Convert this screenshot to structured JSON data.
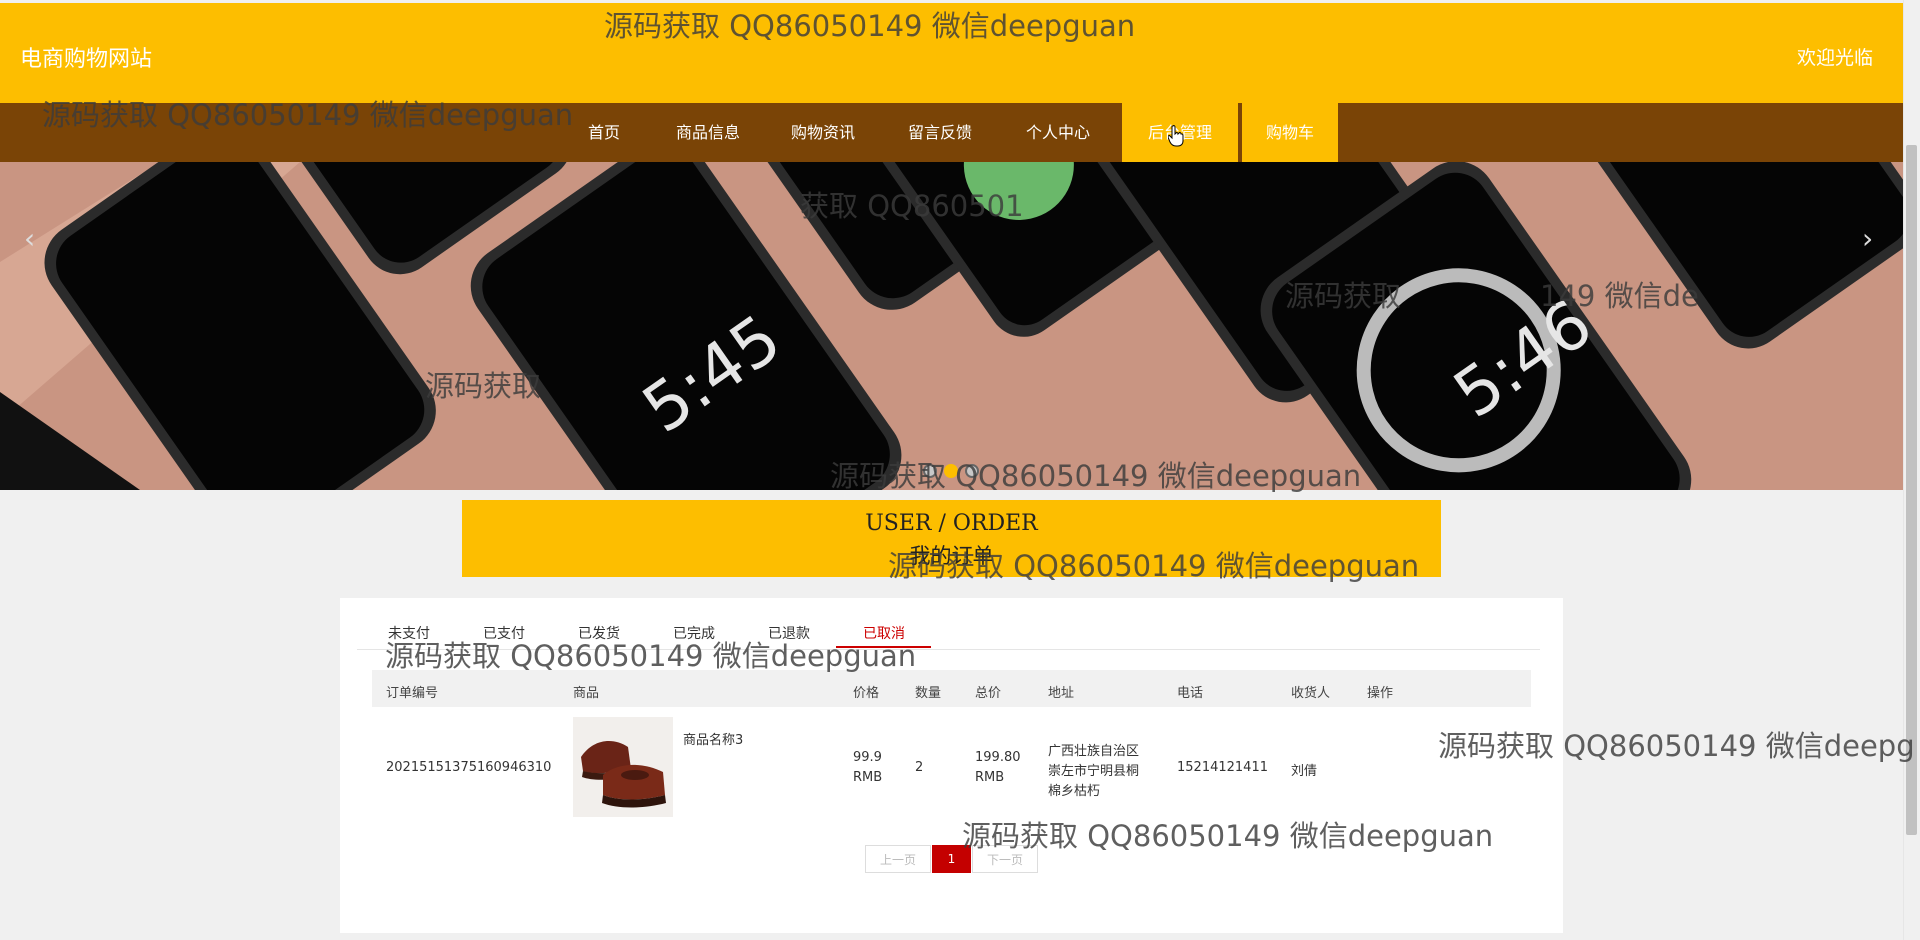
{
  "header": {
    "site_title": "电商购物网站",
    "welcome_text": "欢迎光临"
  },
  "nav": {
    "items": [
      "首页",
      "商品信息",
      "购物资讯",
      "留言反馈",
      "个人中心",
      "后台管理",
      "购物车"
    ],
    "active_items": [
      "后台管理",
      "购物车"
    ]
  },
  "banner": {
    "prev_icon": "‹",
    "next_icon": "›",
    "dot_count": 3,
    "active_dot": 1
  },
  "order_header": {
    "en": "USER / ORDER",
    "cn": "我的订单"
  },
  "tabs": {
    "items": [
      "未支付",
      "已支付",
      "已发货",
      "已完成",
      "已退款",
      "已取消"
    ],
    "active": "已取消"
  },
  "table": {
    "headers": [
      "订单编号",
      "商品",
      "价格",
      "数量",
      "总价",
      "地址",
      "电话",
      "收货人",
      "操作"
    ],
    "row": {
      "order_no": "20215151375160946310",
      "product_name": "商品名称3",
      "price_value": "99.9",
      "price_unit": "RMB",
      "quantity": "2",
      "total_value": "199.80",
      "total_unit": "RMB",
      "address_line1": "广西壮族自治区",
      "address_line2": "崇左市宁明县桐",
      "address_line3": "棉乡枯朽",
      "phone": "15214121411",
      "receiver": "刘倩"
    }
  },
  "pagination": {
    "prev": "上一页",
    "current": "1",
    "next": "下一页"
  },
  "watermarks": {
    "full": "源码获取 QQ86050149 微信deepguan",
    "partial_1": "获取 QQ860501",
    "partial_2": "源码获取",
    "partial_3": "149 微信de",
    "partial_4": "源码获取",
    "partial_5": "源码获取 QQ86050149 微信deepg",
    "partial_6": "源码获取 QQ86050149 微信deepguan"
  },
  "colors": {
    "brand_yellow": "#fdbe00",
    "nav_brown": "#7a4406",
    "active_red": "#c00000"
  }
}
